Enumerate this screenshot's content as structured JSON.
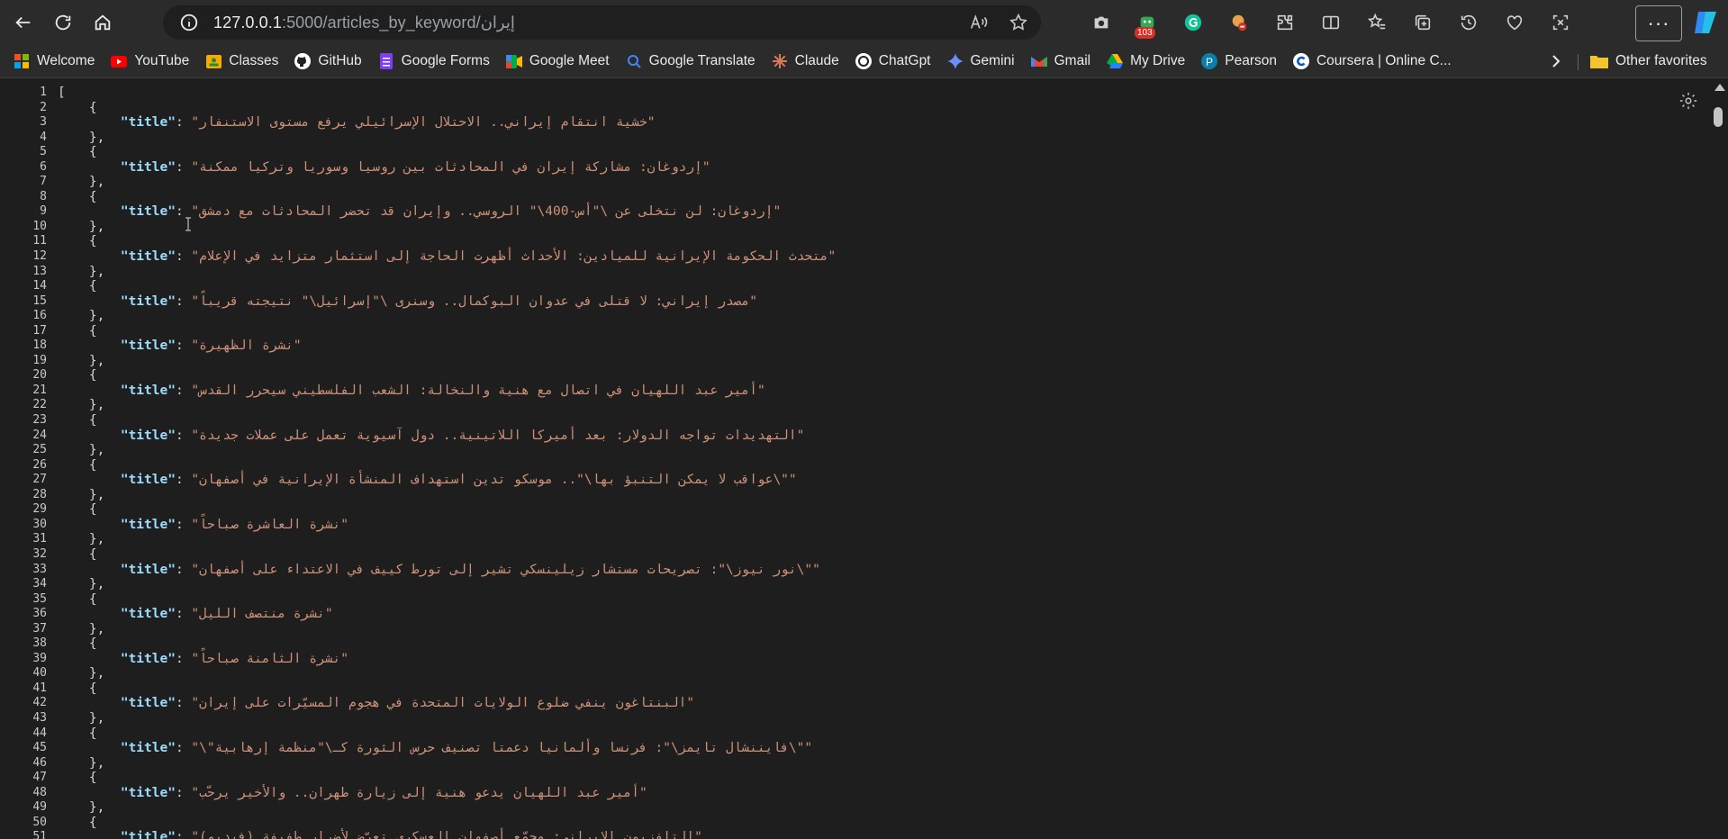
{
  "browser": {
    "url_host": "127.0.0.1",
    "url_path": ":5000/articles_by_keyword/إيران",
    "badge_count": "103",
    "more_label": "···"
  },
  "bookmarks": [
    {
      "label": "Welcome",
      "icon": "microsoft-icon"
    },
    {
      "label": "YouTube",
      "icon": "youtube-icon"
    },
    {
      "label": "Classes",
      "icon": "classes-icon"
    },
    {
      "label": "GitHub",
      "icon": "github-icon"
    },
    {
      "label": "Google Forms",
      "icon": "forms-icon"
    },
    {
      "label": "Google Meet",
      "icon": "meet-icon"
    },
    {
      "label": "Google Translate",
      "icon": "translate-icon"
    },
    {
      "label": "Claude",
      "icon": "claude-icon"
    },
    {
      "label": "ChatGpt",
      "icon": "chatgpt-icon"
    },
    {
      "label": "Gemini",
      "icon": "gemini-icon"
    },
    {
      "label": "Gmail",
      "icon": "gmail-icon"
    },
    {
      "label": "My Drive",
      "icon": "drive-icon"
    },
    {
      "label": "Pearson",
      "icon": "pearson-icon"
    },
    {
      "label": "Coursera | Online C...",
      "icon": "coursera-icon"
    }
  ],
  "other_favorites": "Other favorites",
  "json": {
    "key": "\"title\"",
    "colon": ": ",
    "titles": [
      "\"خشية انتقام إيراني.. الاحتلال الإسرائيلي يرفع مستوى الاستنفار\"",
      "\"إردوغان: مشاركة إيران في المحادثات بين روسيا وسوريا وتركيا ممكنة\"",
      "\"إردوغان: لن نتخلى عن \\\"أس-400\\\" الروسي.. وإيران قد تحضر المحادثات مع دمشق\"",
      "\"متحدث الحكومة الإيرانية للميادين: الأحداث أظهرت الحاجة إلى استثمار متزايد في الإعلام\"",
      "\"مصدر إيراني: لا قتلى في عدوان البوكمال.. وسنرى \\\"إسرائيل\\\" نتيجته قريباً\"",
      "\"نشرة الظهيرة\"",
      "\"أمير عبد اللهيان في اتصال مع هنية والنخالة: الشعب الفلسطيني سيحرر القدس\"",
      "\"التهديدات تواجه الدولار: بعد أميركا اللاتينية.. دول آسيوية تعمل على عملات جديدة\"",
      "\"عواقب لا يمكن التنبؤ بها\\\".. موسكو تدين استهداف المنشأة الإيرانية في أصفهان\\\"\"",
      "\"نشرة العاشرة صباحاً\"",
      "\"نور نيوز\\\": تصريحات مستشار زيلينسكي تشير إلى تورط كييف في الاعتداء على أصفهان\\\"\"",
      "\"نشرة منتصف الليل\"",
      "\"نشرة الثامنة صباحاً\"",
      "\"البنتاغون ينفي ضلوع الولايات المتحدة في هجوم المسيّرات على إيران\"",
      "\"\\\"فايننشال تايمز\\\": فرنسا وألمانيا دعمتا تصنيف حرس الثورة كـ\\\"منظمة إرهابية\\\"\"",
      "\"أمير عبد اللهيان يدعو هنية إلى زيارة طهران.. والأخير يرحّب\"",
      "\"التلفزيون الإيراني: مجمّع أصفهان العسكري تعرّض لأضرار طفيفة (فيديو)\""
    ]
  }
}
